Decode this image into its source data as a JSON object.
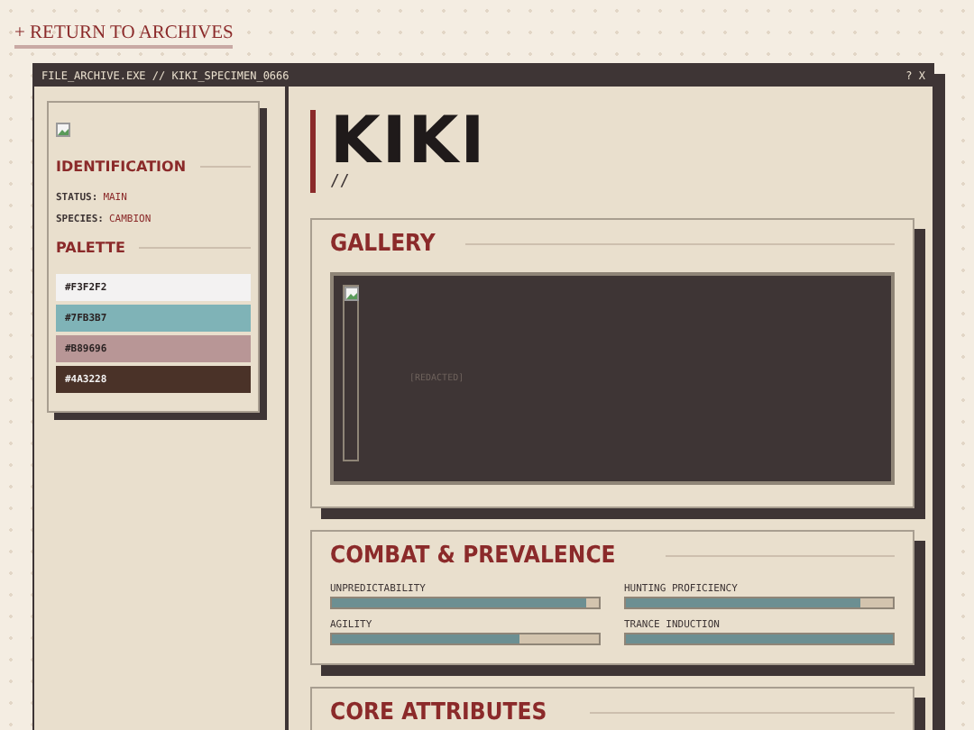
{
  "back_link": "+ RETURN TO ARCHIVES",
  "window": {
    "title": "FILE_ARCHIVE.EXE // KIKI_SPECIMEN_0666",
    "controls": "? X"
  },
  "sidebar": {
    "identification": {
      "heading": "IDENTIFICATION",
      "fields": [
        {
          "label": "STATUS:",
          "value": "MAIN"
        },
        {
          "label": "SPECIES:",
          "value": "CAMBION"
        }
      ]
    },
    "palette": {
      "heading": "PALETTE",
      "swatches": [
        {
          "label": "#F3F2F2",
          "color": "#f3f2f2"
        },
        {
          "label": "#7FB3B7",
          "color": "#7fb3b7"
        },
        {
          "label": "#B89696",
          "color": "#b89696"
        },
        {
          "label": "#4A3228",
          "color": "#4a3228"
        }
      ]
    }
  },
  "name": "KIKI",
  "name_mark": "//",
  "gallery": {
    "heading": "GALLERY",
    "caption": "[REDACTED]"
  },
  "combat": {
    "heading": "COMBAT & PREVALENCE",
    "stats": [
      {
        "label": "UNPREDICTABILITY",
        "level": 0.95
      },
      {
        "label": "HUNTING PROFICIENCY",
        "level": 0.88
      },
      {
        "label": "AGILITY",
        "level": 0.7
      },
      {
        "label": "TRANCE INDUCTION",
        "level": 1
      }
    ]
  },
  "core": {
    "heading": "CORE ATTRIBUTES"
  }
}
